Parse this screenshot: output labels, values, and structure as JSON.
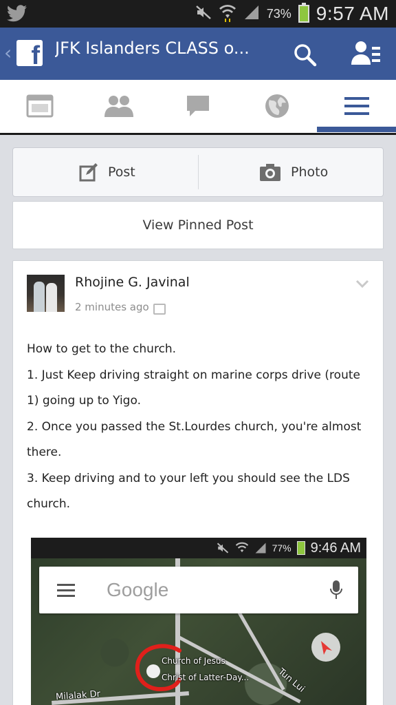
{
  "status_bar": {
    "battery_pct": "73%",
    "time": "9:57 AM",
    "icons": [
      "twitter-icon",
      "mute-icon",
      "wifi-icon",
      "signal-icon",
      "battery-icon"
    ]
  },
  "app_bar": {
    "title": "JFK Islanders CLASS o...",
    "icons": [
      "back-chevron-icon",
      "facebook-logo",
      "search-icon",
      "friend-requests-icon"
    ]
  },
  "tabs": [
    {
      "name": "news-feed",
      "icon": "news-feed-icon"
    },
    {
      "name": "friends",
      "icon": "friends-icon"
    },
    {
      "name": "messages",
      "icon": "chat-bubble-icon"
    },
    {
      "name": "notifications",
      "icon": "globe-icon"
    },
    {
      "name": "more",
      "icon": "menu-icon",
      "active": true
    }
  ],
  "composer": {
    "post_label": "Post",
    "photo_label": "Photo"
  },
  "pinned": {
    "label": "View Pinned Post"
  },
  "post": {
    "author": "Rhojine G. Javinal",
    "timestamp": "2 minutes ago",
    "lines": [
      "How to get to the church.",
      "1. Just Keep driving straight on marine corps drive (route",
      "1) going up to Yigo.",
      "2. Once you passed the St.Lourdes church, you're almost",
      "there.",
      "3. Keep driving and to your left you should see the LDS",
      "church."
    ],
    "embed": {
      "battery_pct": "77%",
      "time": "9:46 AM",
      "search_placeholder": "Google",
      "place_line1": "Church of Jesus",
      "place_line2": "Christ of Latter-Day...",
      "street1": "Milalak Dr",
      "street2": "Tun Lui"
    }
  },
  "colors": {
    "brand_blue": "#3b5998",
    "status_bar": "#1c1c1c",
    "feed_bg": "#dcdee3",
    "annotation_red": "#e0201b",
    "battery_green": "#8ec63f"
  }
}
